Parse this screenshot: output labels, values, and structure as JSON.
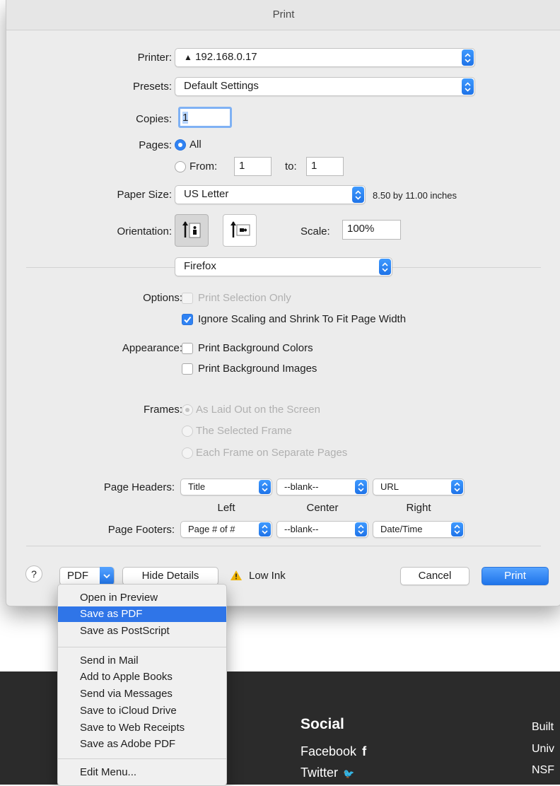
{
  "background": {
    "social_heading": "Social",
    "social_links": [
      "Facebook",
      "Twitter"
    ],
    "facebook_glyph": "f",
    "twitter_glyph": "🐦",
    "right_column": [
      "Built",
      "Univ",
      "NSF"
    ]
  },
  "dialog": {
    "title": "Print",
    "printer": {
      "label": "Printer:",
      "value": "192.168.0.17",
      "warning_glyph": "▲"
    },
    "presets": {
      "label": "Presets:",
      "value": "Default Settings"
    },
    "copies": {
      "label": "Copies:",
      "value": "1"
    },
    "pages": {
      "label": "Pages:",
      "all_label": "All",
      "from_label": "From:",
      "from_value": "1",
      "to_label": "to:",
      "to_value": "1",
      "selected": "All"
    },
    "paper_size": {
      "label": "Paper Size:",
      "value": "US Letter",
      "dimensions": "8.50 by 11.00 inches"
    },
    "orientation": {
      "label": "Orientation:",
      "selected": "portrait"
    },
    "scale": {
      "label": "Scale:",
      "value": "100%"
    },
    "section_menu": "Firefox",
    "options": {
      "label": "Options:",
      "items": [
        {
          "label": "Print Selection Only",
          "checked": false,
          "enabled": false
        },
        {
          "label": "Ignore Scaling and Shrink To Fit Page Width",
          "checked": true,
          "enabled": true
        }
      ]
    },
    "appearance": {
      "label": "Appearance:",
      "items": [
        {
          "label": "Print Background Colors",
          "checked": false
        },
        {
          "label": "Print Background Images",
          "checked": false
        }
      ]
    },
    "frames": {
      "label": "Frames:",
      "items": [
        {
          "label": "As Laid Out on the Screen",
          "selected": true
        },
        {
          "label": "The Selected Frame",
          "selected": false
        },
        {
          "label": "Each Frame on Separate Pages",
          "selected": false
        }
      ]
    },
    "headers": {
      "label": "Page Headers:",
      "left": "Title",
      "center": "--blank--",
      "right": "URL"
    },
    "column_labels": {
      "left": "Left",
      "center": "Center",
      "right": "Right"
    },
    "footers": {
      "label": "Page Footers:",
      "left": "Page # of #",
      "center": "--blank--",
      "right": "Date/Time"
    },
    "bottom": {
      "help": "?",
      "pdf": "PDF",
      "hide_details": "Hide Details",
      "low_ink": "Low Ink",
      "cancel": "Cancel",
      "print": "Print"
    }
  },
  "pdf_menu": {
    "group1": [
      "Open in Preview",
      "Save as PDF",
      "Save as PostScript"
    ],
    "highlighted": "Save as PDF",
    "group2": [
      "Send in Mail",
      "Add to Apple Books",
      "Send via Messages",
      "Save to iCloud Drive",
      "Save to Web Receipts",
      "Save as Adobe PDF"
    ],
    "group3": [
      "Edit Menu..."
    ]
  },
  "colors": {
    "accent": "#2f82f3",
    "menu_highlight": "#2f75e8",
    "footer_bg": "#2b2b2b",
    "warning": "#f0b400"
  }
}
